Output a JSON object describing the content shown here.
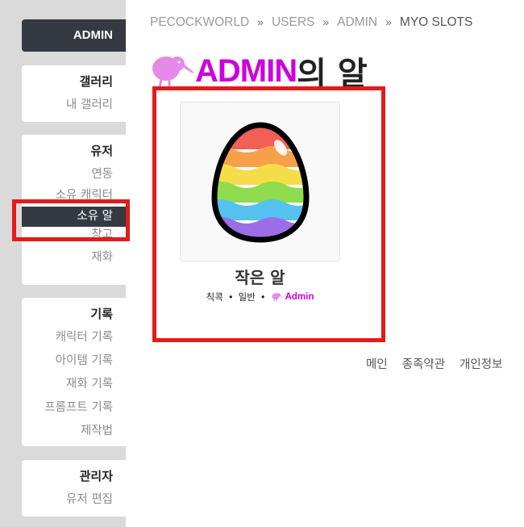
{
  "sidebar": {
    "admin_label": "ADMIN",
    "sections": [
      {
        "heading": "갤러리",
        "items": [
          "내 갤러리"
        ]
      },
      {
        "heading": "유저",
        "items": [
          "연동",
          "소유 캐릭터",
          "소유 알",
          "창고",
          "재화"
        ]
      },
      {
        "heading": "기록",
        "items": [
          "캐릭터 기록",
          "아이템 기록",
          "재화 기록",
          "프롬프트 기록",
          "제작법"
        ]
      },
      {
        "heading": "관리자",
        "items": [
          "유저 편집"
        ]
      }
    ],
    "active_item": "소유 알"
  },
  "breadcrumb": {
    "items": [
      "PECOCKWORLD",
      "USERS",
      "ADMIN",
      "MYO SLOTS"
    ],
    "separator": "»"
  },
  "title": {
    "user": "ADMIN",
    "suffix": "의 알",
    "icon": "kiwi-icon"
  },
  "egg": {
    "name": "작은 알",
    "species": "칙콕",
    "type": "일반",
    "owner": "Admin",
    "dot": "•"
  },
  "footer": {
    "links": [
      "메인",
      "종족약관",
      "개인정보"
    ]
  },
  "colors": {
    "accent": "#cc00dd",
    "sidebar_active": "#343a40",
    "highlight": "#e31b1b"
  }
}
